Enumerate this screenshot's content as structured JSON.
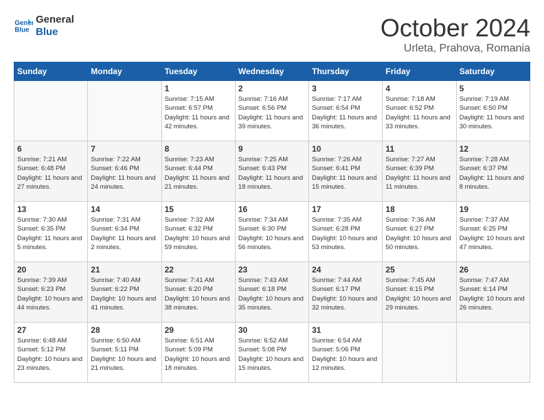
{
  "header": {
    "logo_line1": "General",
    "logo_line2": "Blue",
    "month": "October 2024",
    "location": "Urleta, Prahova, Romania"
  },
  "weekdays": [
    "Sunday",
    "Monday",
    "Tuesday",
    "Wednesday",
    "Thursday",
    "Friday",
    "Saturday"
  ],
  "weeks": [
    [
      {
        "day": "",
        "detail": ""
      },
      {
        "day": "",
        "detail": ""
      },
      {
        "day": "1",
        "detail": "Sunrise: 7:15 AM\nSunset: 6:57 PM\nDaylight: 11 hours and 42 minutes."
      },
      {
        "day": "2",
        "detail": "Sunrise: 7:16 AM\nSunset: 6:56 PM\nDaylight: 11 hours and 39 minutes."
      },
      {
        "day": "3",
        "detail": "Sunrise: 7:17 AM\nSunset: 6:54 PM\nDaylight: 11 hours and 36 minutes."
      },
      {
        "day": "4",
        "detail": "Sunrise: 7:18 AM\nSunset: 6:52 PM\nDaylight: 11 hours and 33 minutes."
      },
      {
        "day": "5",
        "detail": "Sunrise: 7:19 AM\nSunset: 6:50 PM\nDaylight: 11 hours and 30 minutes."
      }
    ],
    [
      {
        "day": "6",
        "detail": "Sunrise: 7:21 AM\nSunset: 6:48 PM\nDaylight: 11 hours and 27 minutes."
      },
      {
        "day": "7",
        "detail": "Sunrise: 7:22 AM\nSunset: 6:46 PM\nDaylight: 11 hours and 24 minutes."
      },
      {
        "day": "8",
        "detail": "Sunrise: 7:23 AM\nSunset: 6:44 PM\nDaylight: 11 hours and 21 minutes."
      },
      {
        "day": "9",
        "detail": "Sunrise: 7:25 AM\nSunset: 6:43 PM\nDaylight: 11 hours and 18 minutes."
      },
      {
        "day": "10",
        "detail": "Sunrise: 7:26 AM\nSunset: 6:41 PM\nDaylight: 11 hours and 15 minutes."
      },
      {
        "day": "11",
        "detail": "Sunrise: 7:27 AM\nSunset: 6:39 PM\nDaylight: 11 hours and 11 minutes."
      },
      {
        "day": "12",
        "detail": "Sunrise: 7:28 AM\nSunset: 6:37 PM\nDaylight: 11 hours and 8 minutes."
      }
    ],
    [
      {
        "day": "13",
        "detail": "Sunrise: 7:30 AM\nSunset: 6:35 PM\nDaylight: 11 hours and 5 minutes."
      },
      {
        "day": "14",
        "detail": "Sunrise: 7:31 AM\nSunset: 6:34 PM\nDaylight: 11 hours and 2 minutes."
      },
      {
        "day": "15",
        "detail": "Sunrise: 7:32 AM\nSunset: 6:32 PM\nDaylight: 10 hours and 59 minutes."
      },
      {
        "day": "16",
        "detail": "Sunrise: 7:34 AM\nSunset: 6:30 PM\nDaylight: 10 hours and 56 minutes."
      },
      {
        "day": "17",
        "detail": "Sunrise: 7:35 AM\nSunset: 6:28 PM\nDaylight: 10 hours and 53 minutes."
      },
      {
        "day": "18",
        "detail": "Sunrise: 7:36 AM\nSunset: 6:27 PM\nDaylight: 10 hours and 50 minutes."
      },
      {
        "day": "19",
        "detail": "Sunrise: 7:37 AM\nSunset: 6:25 PM\nDaylight: 10 hours and 47 minutes."
      }
    ],
    [
      {
        "day": "20",
        "detail": "Sunrise: 7:39 AM\nSunset: 6:23 PM\nDaylight: 10 hours and 44 minutes."
      },
      {
        "day": "21",
        "detail": "Sunrise: 7:40 AM\nSunset: 6:22 PM\nDaylight: 10 hours and 41 minutes."
      },
      {
        "day": "22",
        "detail": "Sunrise: 7:41 AM\nSunset: 6:20 PM\nDaylight: 10 hours and 38 minutes."
      },
      {
        "day": "23",
        "detail": "Sunrise: 7:43 AM\nSunset: 6:18 PM\nDaylight: 10 hours and 35 minutes."
      },
      {
        "day": "24",
        "detail": "Sunrise: 7:44 AM\nSunset: 6:17 PM\nDaylight: 10 hours and 32 minutes."
      },
      {
        "day": "25",
        "detail": "Sunrise: 7:45 AM\nSunset: 6:15 PM\nDaylight: 10 hours and 29 minutes."
      },
      {
        "day": "26",
        "detail": "Sunrise: 7:47 AM\nSunset: 6:14 PM\nDaylight: 10 hours and 26 minutes."
      }
    ],
    [
      {
        "day": "27",
        "detail": "Sunrise: 6:48 AM\nSunset: 5:12 PM\nDaylight: 10 hours and 23 minutes."
      },
      {
        "day": "28",
        "detail": "Sunrise: 6:50 AM\nSunset: 5:11 PM\nDaylight: 10 hours and 21 minutes."
      },
      {
        "day": "29",
        "detail": "Sunrise: 6:51 AM\nSunset: 5:09 PM\nDaylight: 10 hours and 18 minutes."
      },
      {
        "day": "30",
        "detail": "Sunrise: 6:52 AM\nSunset: 5:08 PM\nDaylight: 10 hours and 15 minutes."
      },
      {
        "day": "31",
        "detail": "Sunrise: 6:54 AM\nSunset: 5:06 PM\nDaylight: 10 hours and 12 minutes."
      },
      {
        "day": "",
        "detail": ""
      },
      {
        "day": "",
        "detail": ""
      }
    ]
  ]
}
